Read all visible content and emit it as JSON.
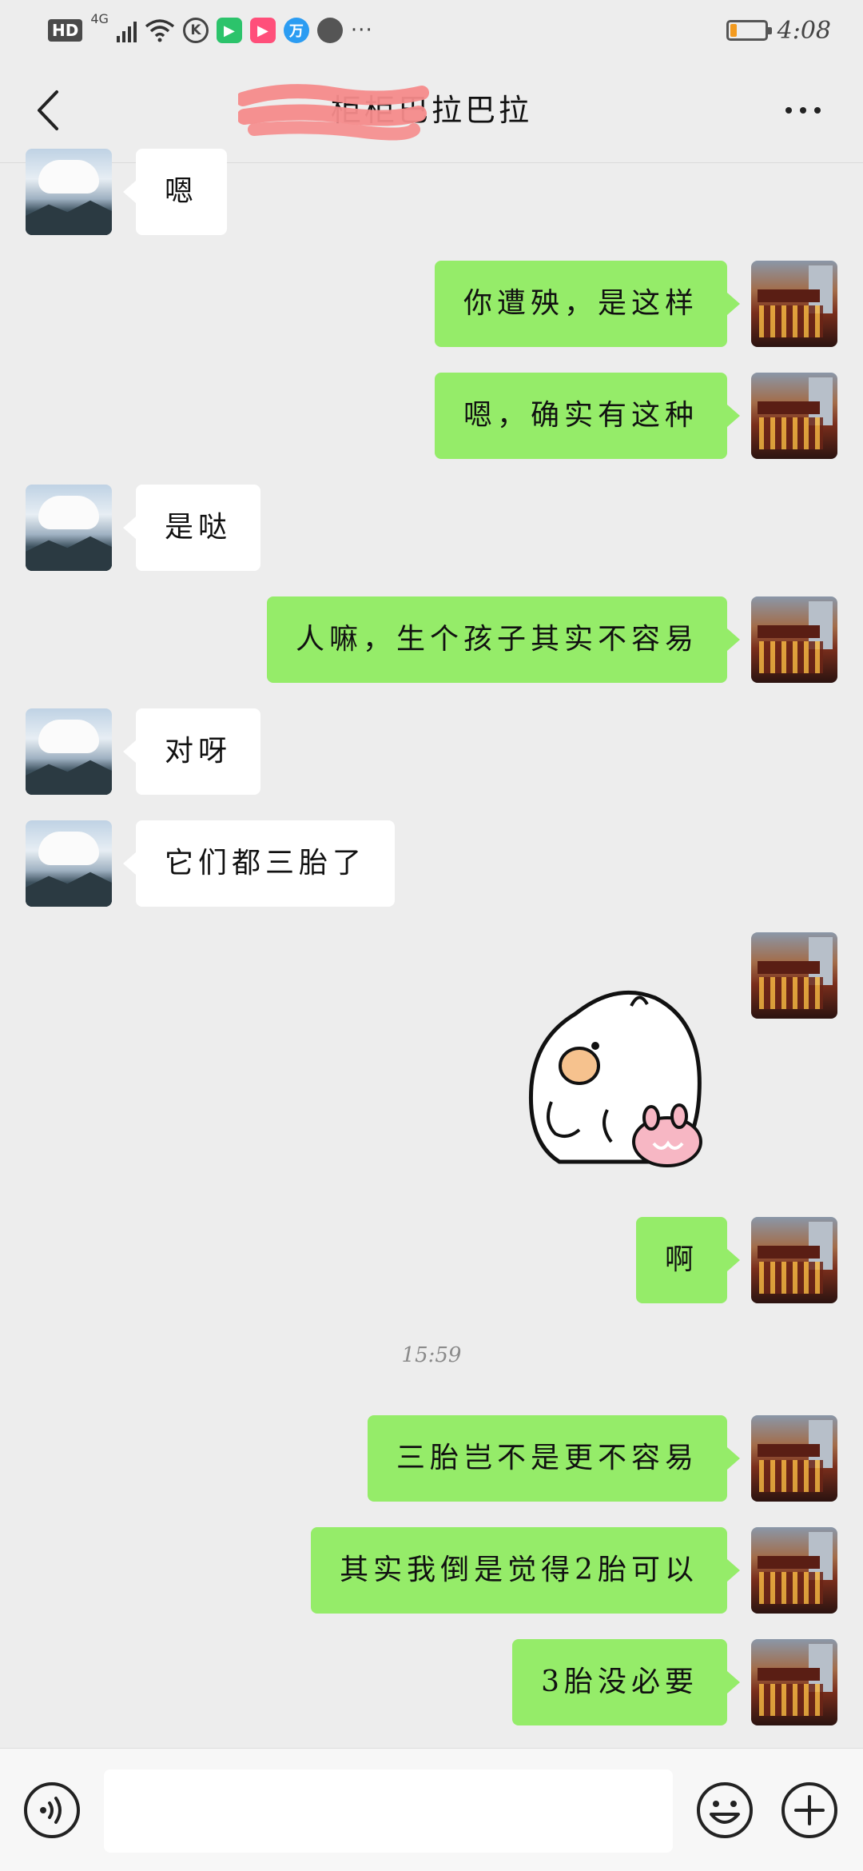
{
  "status_bar": {
    "hd": "HD",
    "network": "4G",
    "time": "4:08",
    "more": "···",
    "battery_level": 0.2,
    "apps": [
      {
        "icon": "k-app-icon",
        "label": "K"
      },
      {
        "icon": "video-app-icon",
        "label": "▶",
        "color": "#2cc36b"
      },
      {
        "icon": "play-app-icon",
        "label": "▶",
        "color": "#ff4f7a"
      },
      {
        "icon": "wan-app-icon",
        "label": "万",
        "color": "#2b9cf2"
      },
      {
        "icon": "globe-app-icon",
        "label": ""
      }
    ]
  },
  "header": {
    "title": "柜柜巴拉巴拉"
  },
  "colors": {
    "background": "#ededed",
    "sent_bubble": "#95ec69",
    "received_bubble": "#ffffff",
    "battery": "#f39a1e"
  },
  "messages": [
    {
      "side": "left",
      "text": "嗯"
    },
    {
      "side": "right",
      "text": "你遭殃，是这样"
    },
    {
      "side": "right",
      "text": "嗯，确实有这种"
    },
    {
      "side": "left",
      "text": "是哒"
    },
    {
      "side": "right",
      "text": "人嘛，生个孩子其实不容易"
    },
    {
      "side": "left",
      "text": "对呀"
    },
    {
      "side": "left",
      "text": "它们都三胎了"
    },
    {
      "side": "right",
      "type": "sticker"
    },
    {
      "side": "right",
      "text": "啊"
    },
    {
      "side": "right",
      "text": "三胎岂不是更不容易"
    },
    {
      "side": "right",
      "text": "其实我倒是觉得2胎可以"
    },
    {
      "side": "right",
      "text": "3胎没必要"
    }
  ],
  "timestamp": "15:59",
  "input": {
    "value": "",
    "placeholder": ""
  }
}
